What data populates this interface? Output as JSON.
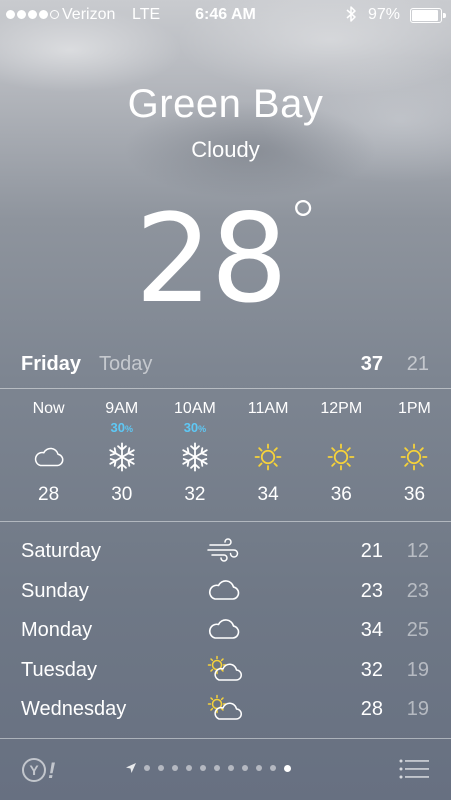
{
  "status_bar": {
    "signal_bars_filled": 4,
    "signal_bars_total": 5,
    "carrier": "Verizon",
    "network": "LTE",
    "time": "6:46 AM",
    "bluetooth_icon": "bluetooth-icon",
    "battery_text": "97%",
    "battery_level": 0.97
  },
  "location": {
    "city": "Green Bay",
    "condition": "Cloudy",
    "temperature": "28",
    "degree_symbol": "°"
  },
  "today": {
    "day": "Friday",
    "label": "Today",
    "high": "37",
    "low": "21"
  },
  "hourly": [
    {
      "time": "Now",
      "pop": "",
      "icon": "cloud-icon",
      "temp": "28"
    },
    {
      "time": "9AM",
      "pop": "30",
      "icon": "snow-icon",
      "temp": "30"
    },
    {
      "time": "10AM",
      "pop": "30",
      "icon": "snow-icon",
      "temp": "32"
    },
    {
      "time": "11AM",
      "pop": "",
      "icon": "sun-icon",
      "temp": "34"
    },
    {
      "time": "12PM",
      "pop": "",
      "icon": "sun-icon",
      "temp": "36"
    },
    {
      "time": "1PM",
      "pop": "",
      "icon": "sun-icon",
      "temp": "36"
    }
  ],
  "pop_unit": "%",
  "daily": [
    {
      "day": "Saturday",
      "icon": "wind-icon",
      "high": "21",
      "low": "12"
    },
    {
      "day": "Sunday",
      "icon": "cloud-icon",
      "high": "23",
      "low": "23"
    },
    {
      "day": "Monday",
      "icon": "cloud-icon",
      "high": "34",
      "low": "25"
    },
    {
      "day": "Tuesday",
      "icon": "partly-sunny-icon",
      "high": "32",
      "low": "19"
    },
    {
      "day": "Wednesday",
      "icon": "partly-sunny-icon",
      "high": "28",
      "low": "19"
    }
  ],
  "bottom_bar": {
    "logo": "Y!",
    "page_count": 11,
    "active_page": 11,
    "list_icon": "list-icon"
  },
  "colors": {
    "precip_blue": "#5ec8f5",
    "sun_yellow": "#f6d23a",
    "text": "#ffffff"
  }
}
